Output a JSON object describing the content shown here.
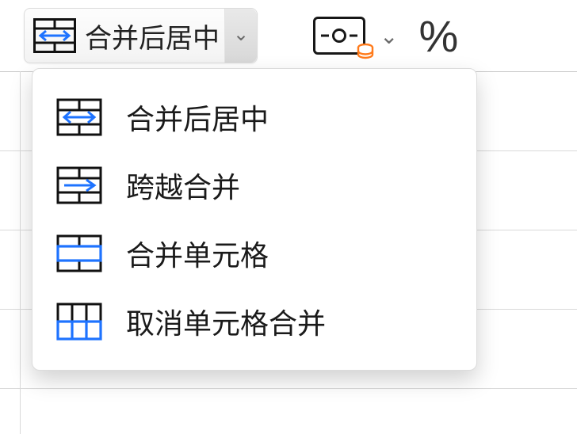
{
  "toolbar": {
    "merge_button": {
      "label": "合并后居中",
      "icon": "merge-center-icon"
    },
    "currency": {
      "icon": "currency-icon",
      "badge": "database-badge"
    },
    "percent_label": "%"
  },
  "dropdown": {
    "items": [
      {
        "icon": "merge-center-icon",
        "label": "合并后居中"
      },
      {
        "icon": "merge-across-icon",
        "label": "跨越合并"
      },
      {
        "icon": "merge-cells-icon",
        "label": "合并单元格"
      },
      {
        "icon": "unmerge-cells-icon",
        "label": "取消单元格合并"
      }
    ]
  }
}
